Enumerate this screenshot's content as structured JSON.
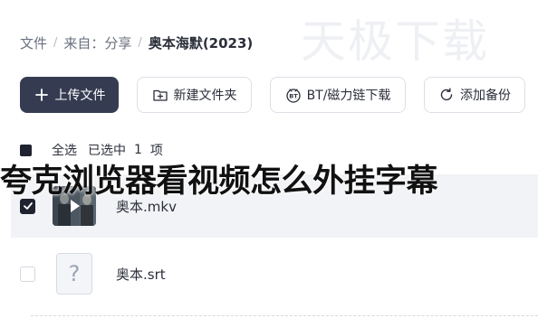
{
  "watermark": "天极下载",
  "breadcrumb": {
    "items": [
      "文件",
      "来自：分享",
      "奥本海默(2023)"
    ],
    "separator": "/"
  },
  "toolbar": {
    "upload_label": "上传文件",
    "new_folder_label": "新建文件夹",
    "bt_label": "BT/磁力链下载",
    "backup_label": "添加备份"
  },
  "selection": {
    "select_all_label": "全选",
    "selected_text": "已选中",
    "selected_count": "1",
    "unit": "项"
  },
  "overlay_title": "夸克浏览器看视频怎么外挂字幕",
  "files": [
    {
      "name": "奥本.mkv",
      "type": "video",
      "checked": true
    },
    {
      "name": "奥本.srt",
      "type": "subtitle",
      "checked": false
    }
  ],
  "icons": {
    "upload": "plus-icon",
    "new_folder": "folder-plus-icon",
    "bt": "bt-icon",
    "backup": "sync-icon",
    "play": "play-icon",
    "unknown_file": "question-mark-icon"
  },
  "colors": {
    "primary_button": "#353c52",
    "selected_row": "#f2f3f6",
    "checkbox": "#1f2330"
  }
}
